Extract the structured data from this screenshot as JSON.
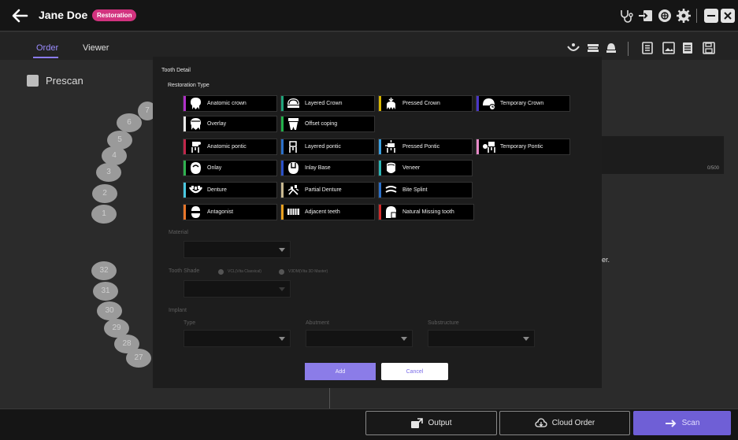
{
  "header": {
    "patient_name": "Jane Doe",
    "badge": "Restoration",
    "badge_color": "#d2337f",
    "icons": [
      "stethoscope-icon",
      "export-icon",
      "globe-icon",
      "settings-icon",
      "minimize-icon",
      "close-icon"
    ]
  },
  "tabs": [
    {
      "label": "Order",
      "active": true
    },
    {
      "label": "Viewer",
      "active": false
    }
  ],
  "accent_color": "#8b7cf6",
  "left": {
    "prescan_label": "Prescan",
    "upper_teeth": [
      "7",
      "6",
      "5",
      "4",
      "3",
      "2",
      "1"
    ],
    "lower_teeth": [
      "32",
      "31",
      "30",
      "29",
      "28",
      "27"
    ]
  },
  "right": {
    "counter": "0/500",
    "partial_text": "der."
  },
  "modal": {
    "title": "Tooth Detail",
    "restoration_type_label": "Restoration Type",
    "options": [
      {
        "label": "Anatomic crown",
        "color": "#b030c8"
      },
      {
        "label": "Layered Crown",
        "color": "#1fa37a"
      },
      {
        "label": "Pressed Crown",
        "color": "#d7b500"
      },
      {
        "label": "Temporary Crown",
        "color": "#4a36c8"
      },
      {
        "label": "Overlay",
        "color": "#e8e8e8"
      },
      {
        "label": "Offset coping",
        "color": "#22b04a"
      },
      {
        "label": "Anatomic pontic",
        "color": "#c0264a"
      },
      {
        "label": "Layered pontic",
        "color": "#2a6fc8"
      },
      {
        "label": "Pressed Pontic",
        "color": "#3aa0e0"
      },
      {
        "label": "Temporary Pontic",
        "color": "#e88ac8"
      },
      {
        "label": "Onlay",
        "color": "#2fb24f"
      },
      {
        "label": "Inlay Base",
        "color": "#2a50c8"
      },
      {
        "label": "Veneer",
        "color": "#2ab3b3"
      },
      {
        "label": "Denture",
        "color": "#4ac8e0"
      },
      {
        "label": "Partial Denture",
        "color": "#c8b890"
      },
      {
        "label": "Bite Splint",
        "color": "#2a6fc8"
      },
      {
        "label": "Antagonist",
        "color": "#e8762a"
      },
      {
        "label": "Adjacent teeth",
        "color": "#e8a020"
      },
      {
        "label": "Natural Missing tooth",
        "color": "#d02a2a"
      }
    ],
    "material_label": "Material",
    "tooth_shade_label": "Tooth Shade",
    "shade_options": [
      "VCL(Vita Classical)",
      "V3DM(Vita 3D Master)"
    ],
    "implant_label": "Implant",
    "type_label": "Type",
    "abutment_label": "Abutment",
    "substructure_label": "Substructure",
    "add_label": "Add",
    "cancel_label": "Cancel"
  },
  "bottom": {
    "output_label": "Output",
    "cloud_order_label": "Cloud Order",
    "scan_label": "Scan"
  }
}
